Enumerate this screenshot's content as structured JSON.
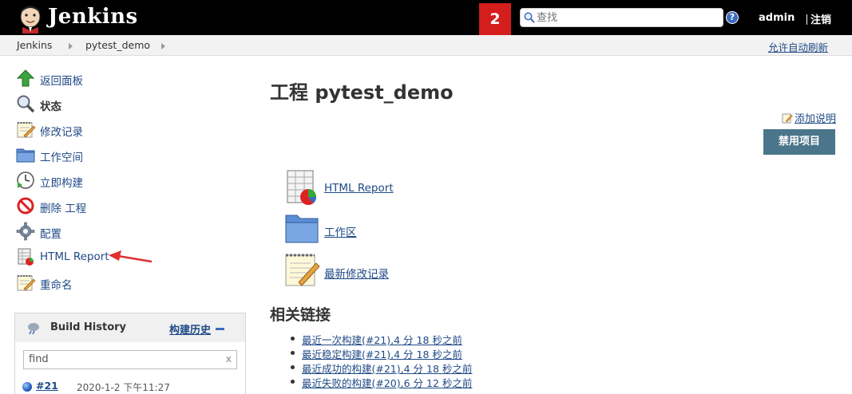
{
  "header": {
    "brand": "Jenkins",
    "notification_count": "2",
    "search": {
      "placeholder": "查找"
    },
    "help_icon": "?",
    "user": "admin",
    "logout": "注销"
  },
  "breadcrumb": {
    "items": [
      "Jenkins",
      "pytest_demo"
    ],
    "auto_refresh": "允许自动刷新"
  },
  "sidebar": {
    "tasks": [
      {
        "label": "返回面板",
        "icon": "up-arrow-icon"
      },
      {
        "label": "状态",
        "icon": "magnifier-icon"
      },
      {
        "label": "修改记录",
        "icon": "notepad-icon"
      },
      {
        "label": "工作空间",
        "icon": "folder-icon"
      },
      {
        "label": "立即构建",
        "icon": "clock-build-icon"
      },
      {
        "label": "删除 工程",
        "icon": "no-entry-icon"
      },
      {
        "label": "配置",
        "icon": "gear-icon"
      },
      {
        "label": "HTML Report",
        "icon": "report-icon"
      },
      {
        "label": "重命名",
        "icon": "notepad-icon"
      }
    ]
  },
  "build_history": {
    "title": "Build History",
    "trend_link": "构建历史",
    "find_placeholder": "find",
    "find_value": "find",
    "clear": "x",
    "builds": [
      {
        "number": "#21",
        "date": "2020-1-2 下午11:27",
        "status_color": "#2a64c9"
      }
    ]
  },
  "main": {
    "title": "工程 pytest_demo",
    "add_description": "添加说明",
    "disable_button": "禁用项目",
    "links": [
      {
        "label": "HTML Report",
        "icon": "report-icon"
      },
      {
        "label": "工作区",
        "icon": "folder-icon"
      },
      {
        "label": "最新修改记录",
        "icon": "notepad-icon"
      }
    ],
    "related_title": "相关链接",
    "related_links": [
      "最近一次构建(#21),4 分 18 秒之前",
      "最近稳定构建(#21),4 分 18 秒之前",
      "最近成功的构建(#21),4 分 18 秒之前",
      "最近失败的构建(#20),6 分 12 秒之前"
    ]
  },
  "annotation": {
    "arrow_color": "#e03030"
  }
}
